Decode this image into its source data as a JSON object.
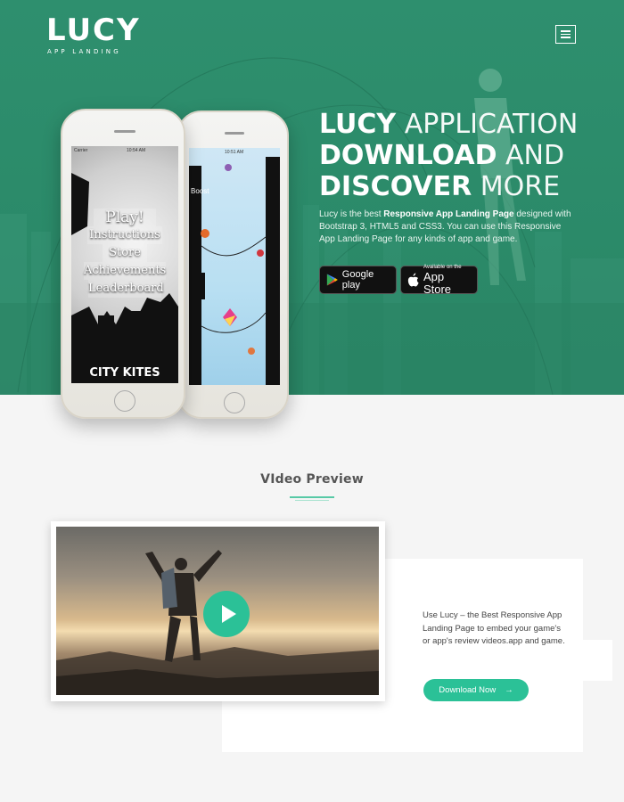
{
  "brand": {
    "name": "LUCY",
    "tagline": "APP LANDING"
  },
  "hero": {
    "headline_line1_bold": "LUCY",
    "headline_line1_thin": "APPLICATION",
    "headline_line2_bold": "DOWNLOAD",
    "headline_line2_thin": "AND",
    "headline_line3_bold": "DISCOVER",
    "headline_line3_thin": "MORE",
    "desc_prefix": "Lucy is the best ",
    "desc_bold": "Responsive App Landing Page",
    "desc_suffix": " designed with Bootstrap 3, HTML5 and CSS3. You can use this Responsive App Landing Page for any kinds of app and game.",
    "google_play_label": "Google play",
    "app_store_small": "Available on the",
    "app_store_big": "App Store"
  },
  "phone_screen": {
    "carrier": "Carrier",
    "time_front": "10:54 AM",
    "time_back": "10:51 AM",
    "menu": [
      "Play!",
      "Instructions",
      "Store",
      "Achievements",
      "Leaderboard"
    ],
    "game_title": "CITY KITES",
    "boost_label": "Boost"
  },
  "video_section": {
    "title": "VIdeo Preview",
    "description": "Use Lucy – the Best Responsive App Landing Page to embed your game's or app's review videos.app and game.",
    "download_label": "Download Now",
    "download_arrow": "→"
  },
  "colors": {
    "accent": "#2bc197",
    "hero_bg": "#2b8a69"
  },
  "icons": {
    "menu": "hamburger-icon",
    "google": "google-play-icon",
    "apple": "apple-icon",
    "play": "play-icon"
  }
}
